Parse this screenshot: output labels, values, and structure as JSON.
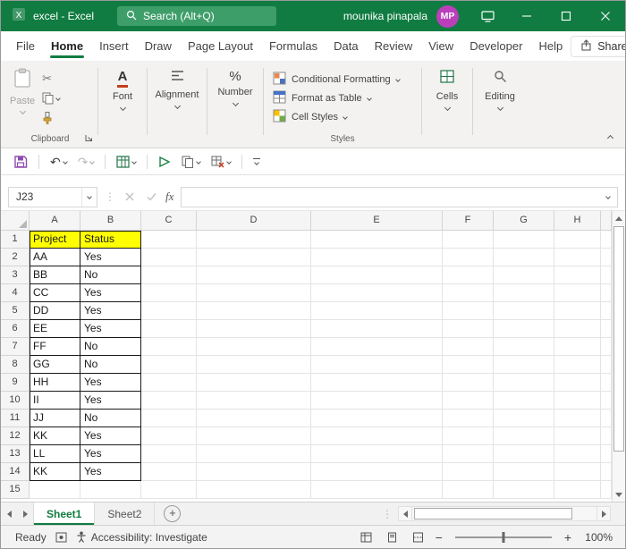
{
  "theme": {
    "accent_green": "#107C41",
    "search_pill_green": "#3E9E6A",
    "avatar_purple": "#BB3FBB",
    "table_header_fill": "#FFFF00"
  },
  "title_bar": {
    "app_title": "excel  -  Excel",
    "search_placeholder": "Search (Alt+Q)",
    "user_name": "mounika pinapala",
    "user_initials": "MP"
  },
  "menu_bar": {
    "tabs": [
      "File",
      "Home",
      "Insert",
      "Draw",
      "Page Layout",
      "Formulas",
      "Data",
      "Review",
      "View",
      "Developer",
      "Help"
    ],
    "active_tab": "Home",
    "share_label": "Share"
  },
  "ribbon": {
    "paste": "Paste",
    "font": "Font",
    "alignment": "Alignment",
    "number": "Number",
    "conditional_formatting": "Conditional Formatting",
    "format_as_table": "Format as Table",
    "cell_styles": "Cell Styles",
    "cells": "Cells",
    "editing": "Editing",
    "group_clipboard": "Clipboard",
    "group_styles": "Styles"
  },
  "formula_bar": {
    "name_box": "J23",
    "fx": "fx",
    "content": ""
  },
  "grid": {
    "columns": [
      "A",
      "B",
      "C",
      "D",
      "E",
      "F",
      "G",
      "H"
    ],
    "rows_visible": 15,
    "table": {
      "range_headers": [
        "Project",
        "Status"
      ],
      "headers": [
        "Project",
        "Status"
      ],
      "data": [
        [
          "AA",
          "Yes"
        ],
        [
          "BB",
          "No"
        ],
        [
          "CC",
          "Yes"
        ],
        [
          "DD",
          "Yes"
        ],
        [
          "EE",
          "Yes"
        ],
        [
          "FF",
          "No"
        ],
        [
          "GG",
          "No"
        ],
        [
          "HH",
          "Yes"
        ],
        [
          "II",
          "Yes"
        ],
        [
          "JJ",
          "No"
        ],
        [
          "KK",
          "Yes"
        ],
        [
          "LL",
          "Yes"
        ],
        [
          "KK",
          "Yes"
        ]
      ]
    }
  },
  "sheet_tabs": {
    "tabs": [
      "Sheet1",
      "Sheet2"
    ],
    "active": "Sheet1"
  },
  "status_bar": {
    "mode": "Ready",
    "accessibility": "Accessibility: Investigate",
    "zoom": "100%"
  }
}
